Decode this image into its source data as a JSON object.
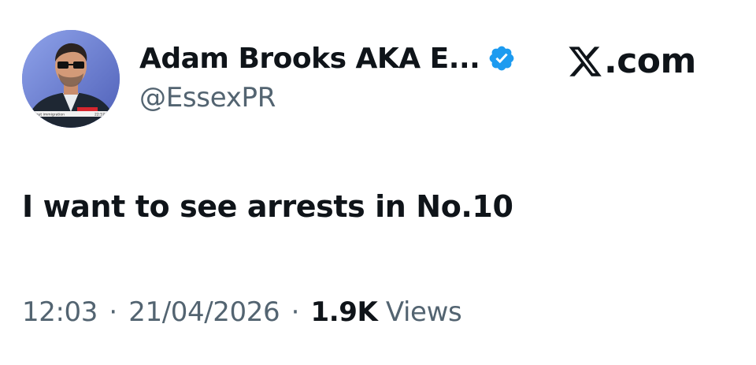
{
  "author": {
    "display_name": "Adam Brooks AKA E...",
    "handle": "@EssexPR",
    "verified": true,
    "avatar_icon": "profile-photo-avatar",
    "avatar_caption": "one out immigration",
    "avatar_time": "22:57"
  },
  "brand": {
    "icon": "x-logo-icon",
    "text": ".com"
  },
  "tweet": {
    "text": "I want to see arrests in No.10"
  },
  "meta": {
    "time": "12:03",
    "separator": "·",
    "date": "21/04/2026",
    "views_count": "1.9K",
    "views_label": "Views"
  },
  "colors": {
    "text_primary": "#0f1419",
    "text_secondary": "#536471",
    "verified_blue": "#1d9bf0",
    "background": "#ffffff"
  }
}
